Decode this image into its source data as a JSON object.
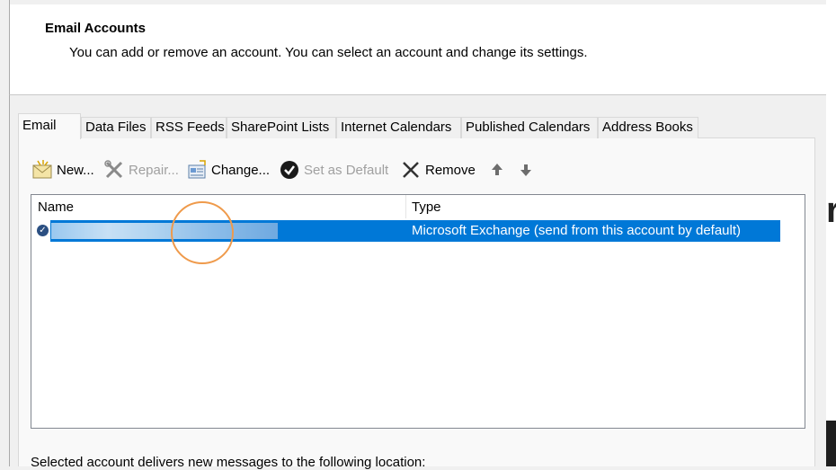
{
  "header": {
    "title": "Email Accounts",
    "description": "You can add or remove an account. You can select an account and change its settings."
  },
  "tabs": [
    {
      "label": "Email",
      "active": true
    },
    {
      "label": "Data Files"
    },
    {
      "label": "RSS Feeds"
    },
    {
      "label": "SharePoint Lists"
    },
    {
      "label": "Internet Calendars"
    },
    {
      "label": "Published Calendars"
    },
    {
      "label": "Address Books"
    }
  ],
  "toolbar": {
    "new": "New...",
    "repair": "Repair...",
    "change": "Change...",
    "set_default": "Set as Default",
    "remove": "Remove"
  },
  "list": {
    "columns": [
      "Name",
      "Type"
    ],
    "rows": [
      {
        "name": "",
        "type": "Microsoft Exchange (send from this account by default)",
        "selected": true,
        "default": true
      }
    ]
  },
  "footer": {
    "text": "Selected account delivers new messages to the following location:"
  },
  "colors": {
    "selection": "#0078d7",
    "accent_cursor": "#ef9a4b"
  }
}
